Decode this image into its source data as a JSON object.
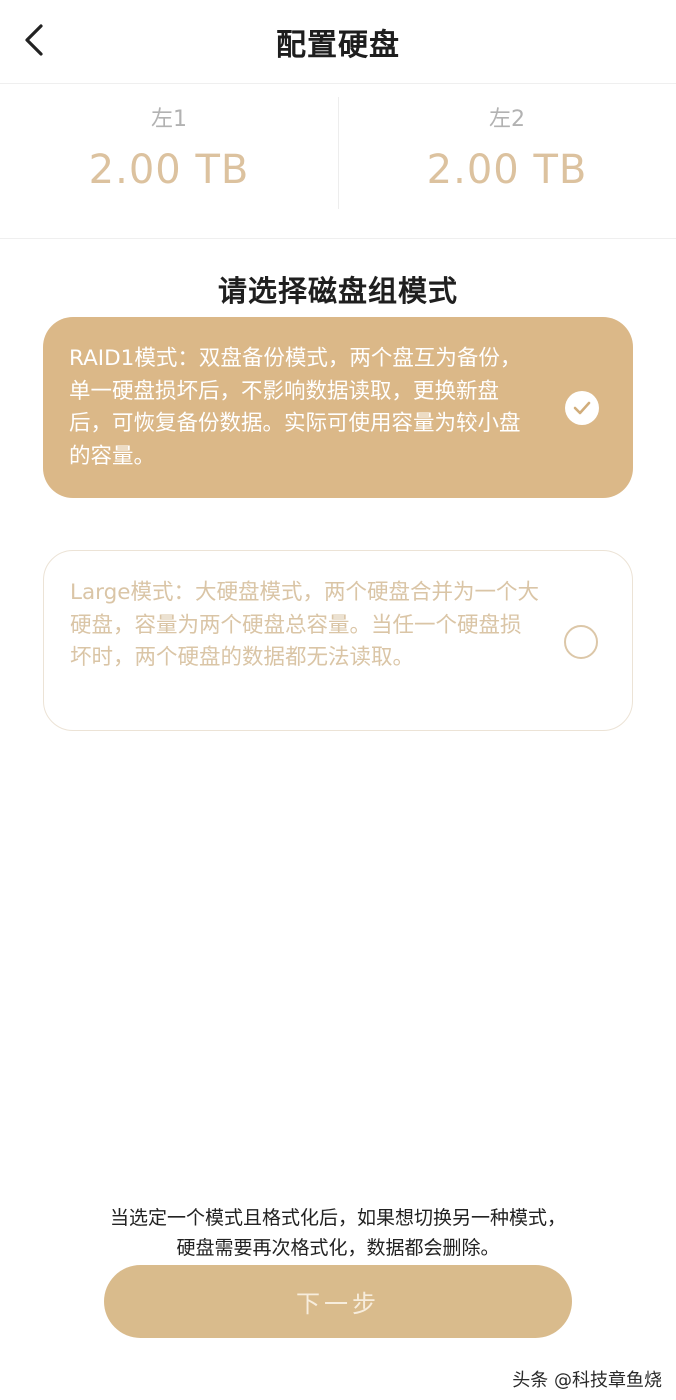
{
  "header": {
    "title": "配置硬盘",
    "back_icon": "chevron-left-icon"
  },
  "disks": [
    {
      "name": "左1",
      "size": "2.00 TB"
    },
    {
      "name": "左2",
      "size": "2.00 TB"
    }
  ],
  "section_title": "请选择磁盘组模式",
  "modes": [
    {
      "text": "RAID1模式：双盘备份模式，两个盘互为备份，单一硬盘损坏后，不影响数据读取，更换新盘后，可恢复备份数据。实际可使用容量为较小盘的容量。",
      "selected": true
    },
    {
      "text": "Large模式：大硬盘模式，两个硬盘合并为一个大硬盘，容量为两个硬盘总容量。当任一个硬盘损坏时，两个硬盘的数据都无法读取。",
      "selected": false
    }
  ],
  "notice": {
    "line1": "当选定一个模式且格式化后，如果想切换另一种模式，",
    "line2": "硬盘需要再次格式化，数据都会删除。"
  },
  "next_button_label": "下一步",
  "watermark": "头条 @科技章鱼烧",
  "colors": {
    "accent": "#dbb888",
    "accent_light": "#dcc29f",
    "unselected_text": "#dac5a6"
  }
}
